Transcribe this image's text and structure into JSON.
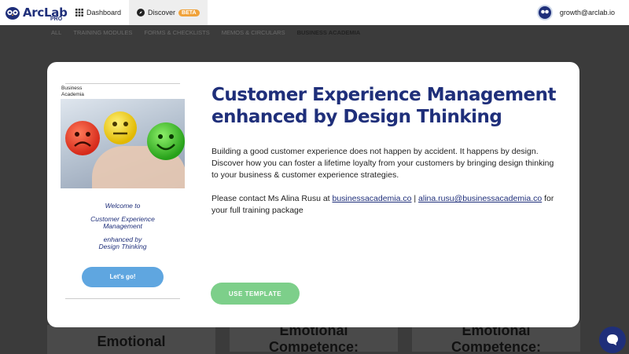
{
  "app": {
    "logo_text": "ArcLab",
    "logo_sub": "PRO"
  },
  "nav": {
    "dashboard_label": "Dashboard",
    "discover_label": "Discover",
    "discover_badge": "BETA"
  },
  "user": {
    "email": "growth@arclab.io"
  },
  "categories": {
    "all": "ALL",
    "training": "TRAINING MODULES",
    "forms": "FORMS & CHECKLISTS",
    "memos": "MEMOS & CIRCULARS",
    "business": "BUSINESS ACADEMIA"
  },
  "background_cards": {
    "card1": "Emotional",
    "card2_line1": "Emotional",
    "card2_line2": "Competence:",
    "card3_line1": "Emotional",
    "card3_line2": "Competence:"
  },
  "modal": {
    "brand_line1": "Business",
    "brand_line2": "Academia",
    "welcome_line1": "Welcome to",
    "welcome_line2": "Customer Experience",
    "welcome_line3": "Management",
    "welcome_line4": "enhanced by",
    "welcome_line5": "Design Thinking",
    "lets_go": "Let's go!",
    "title": "Customer Experience Management enhanced by Design Thinking",
    "description": "Building a good customer experience does not happen by accident. It happens by design. Discover how you can foster a lifetime loyalty from your customers by bringing design thinking to your business & customer experience strategies.",
    "contact_prefix": "Please contact Ms Alina Rusu at ",
    "contact_link1": "businessacademia.co",
    "contact_sep": " | ",
    "contact_link2": "alina.rusu@businessacademia.co",
    "contact_suffix": " for your full training package",
    "use_template": "USE TEMPLATE"
  },
  "colors": {
    "brand_navy": "#1f2f7a",
    "beta_badge": "#f0a23a",
    "lets_go_button": "#5fa6e0",
    "use_template_button": "#7dcf8a"
  },
  "icons": {
    "logo": "owl-logo-icon",
    "dashboard": "grid-icon",
    "discover": "compass-icon",
    "chat": "chat-bubble-icon"
  }
}
